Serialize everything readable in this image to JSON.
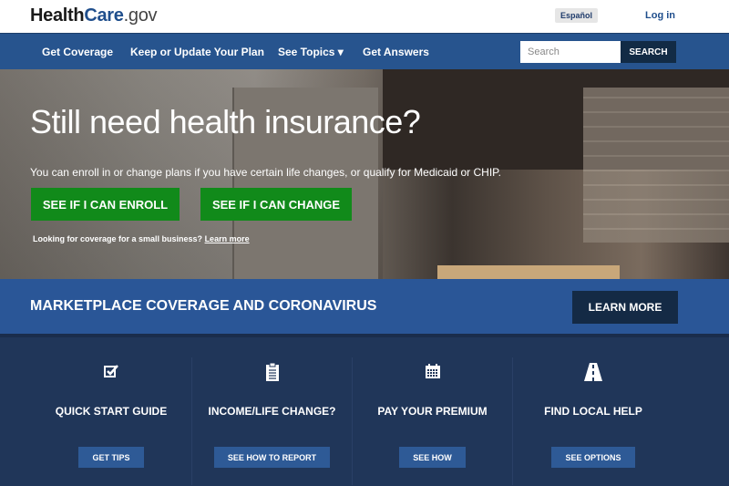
{
  "header": {
    "logo": {
      "part1": "Health",
      "part2": "Care",
      "part3": ".gov"
    },
    "language_label": "Español",
    "login_label": "Log in"
  },
  "nav": {
    "items": [
      {
        "label": "Get Coverage"
      },
      {
        "label": "Keep or Update Your Plan"
      },
      {
        "label": "See Topics ▾"
      },
      {
        "label": "Get Answers"
      }
    ],
    "search": {
      "placeholder": "Search",
      "value": "",
      "button_label": "SEARCH"
    }
  },
  "hero": {
    "title": "Still need health insurance?",
    "subtitle": "You can enroll in or change plans if you have certain life changes, or qualify for Medicaid or CHIP.",
    "buttons": [
      {
        "label": "SEE IF I CAN ENROLL"
      },
      {
        "label": "SEE IF I CAN CHANGE"
      }
    ],
    "small_business_text": "Looking for coverage for a small business?",
    "small_business_link": "Learn more"
  },
  "banner": {
    "title": "MARKETPLACE COVERAGE AND CORONAVIRUS",
    "button_label": "LEARN MORE"
  },
  "cards": [
    {
      "icon": "checkbox-icon",
      "title": "QUICK START GUIDE",
      "button_label": "GET TIPS"
    },
    {
      "icon": "clipboard-icon",
      "title": "INCOME/LIFE CHANGE?",
      "button_label": "SEE HOW TO REPORT"
    },
    {
      "icon": "calendar-icon",
      "title": "PAY YOUR PREMIUM",
      "button_label": "SEE HOW"
    },
    {
      "icon": "road-icon",
      "title": "FIND LOCAL HELP",
      "button_label": "SEE OPTIONS"
    }
  ],
  "colors": {
    "nav_blue": "#27548e",
    "green": "#118a1a",
    "banner_blue": "#2a5697",
    "dark_navy": "#203659"
  }
}
